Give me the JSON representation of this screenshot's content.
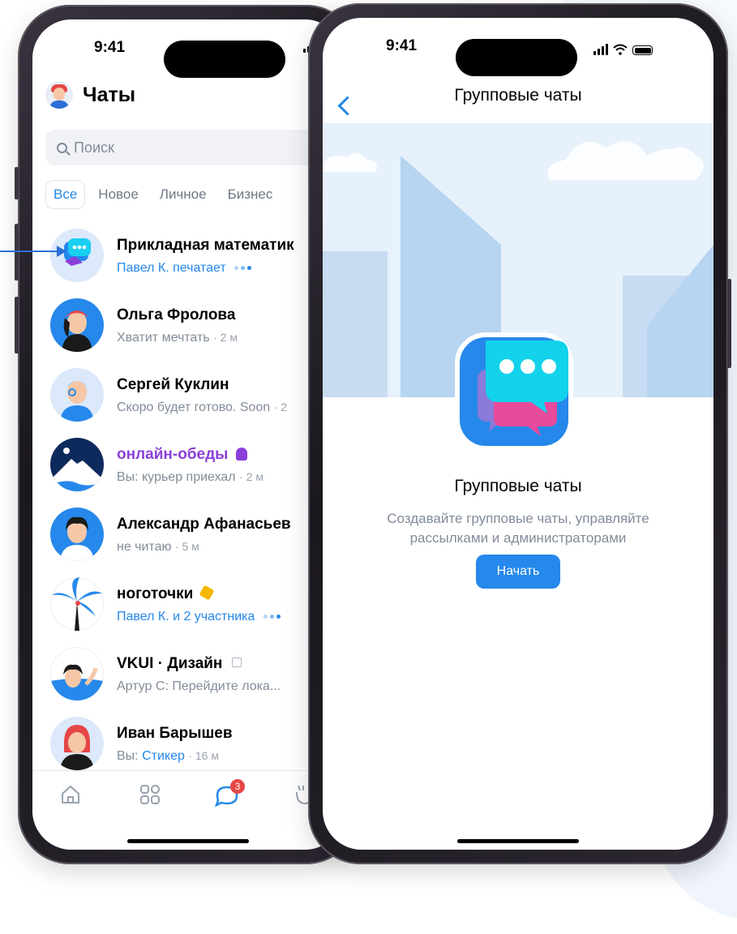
{
  "colors": {
    "accent": "#2688eb",
    "purple": "#8b3fd9",
    "badge": "#e64646"
  },
  "left_phone": {
    "status_time": "9:41",
    "header": {
      "title": "Чаты"
    },
    "search": {
      "placeholder": "Поиск"
    },
    "filter_tabs": [
      {
        "label": "Все",
        "active": true
      },
      {
        "label": "Новое"
      },
      {
        "label": "Личное"
      },
      {
        "label": "Бизнес"
      }
    ],
    "chats": [
      {
        "name": "Прикладная математик",
        "preview_blue": "Павел К. печатает",
        "typing": true
      },
      {
        "name": "Ольга Фролова",
        "preview": "Хватит мечтать",
        "time": "· 2 м"
      },
      {
        "name": "Сергей Куклин",
        "preview": "Скоро будет готово. Soon",
        "time": "· 2"
      },
      {
        "name": "онлайн-обеды",
        "preview": "Вы: курьер приехал",
        "time": "· 2 м"
      },
      {
        "name": "Александр Афанасьев",
        "preview": "не читаю",
        "time": "· 5 м"
      },
      {
        "name": "ноготочки",
        "preview_blue": "Павел К. и 2 участника",
        "typing": true
      },
      {
        "name": "VKUI · Дизайн",
        "preview": "Артур С: Перейдите лока..."
      },
      {
        "name": "Иван Барышев",
        "preview": "Вы: ",
        "preview_blue": "Стикер",
        "time": "· 16 м"
      }
    ],
    "tabbar": {
      "badge_count": "3"
    }
  },
  "right_phone": {
    "status_time": "9:41",
    "nav_title": "Групповые чаты",
    "heading": "Групповые чаты",
    "description_line1": "Создавайте групповые чаты, управляйте",
    "description_line2": "рассылками и администраторами",
    "button_label": "Начать"
  }
}
